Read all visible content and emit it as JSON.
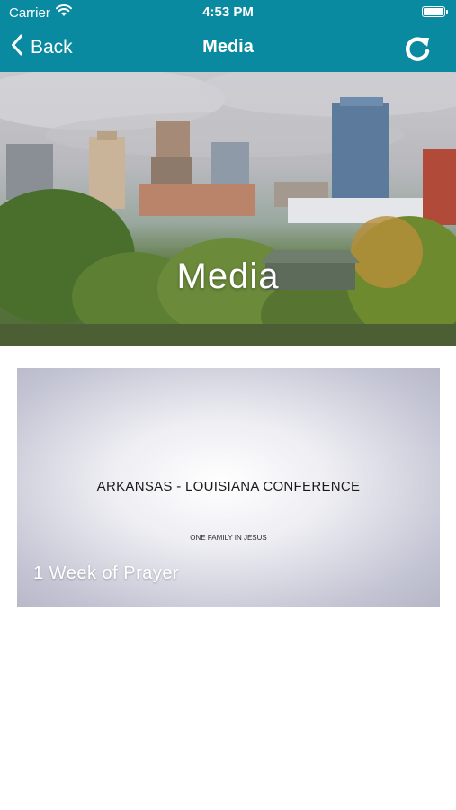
{
  "status_bar": {
    "carrier": "Carrier",
    "time": "4:53 PM"
  },
  "nav": {
    "back_label": "Back",
    "title": "Media"
  },
  "hero": {
    "title": "Media"
  },
  "media_items": [
    {
      "headline": "ARKANSAS - LOUISIANA CONFERENCE",
      "subline": "ONE FAMILY IN JESUS",
      "label": "1 Week of Prayer"
    }
  ],
  "colors": {
    "header": "#0a8aa0",
    "text_on_header": "#ffffff"
  }
}
